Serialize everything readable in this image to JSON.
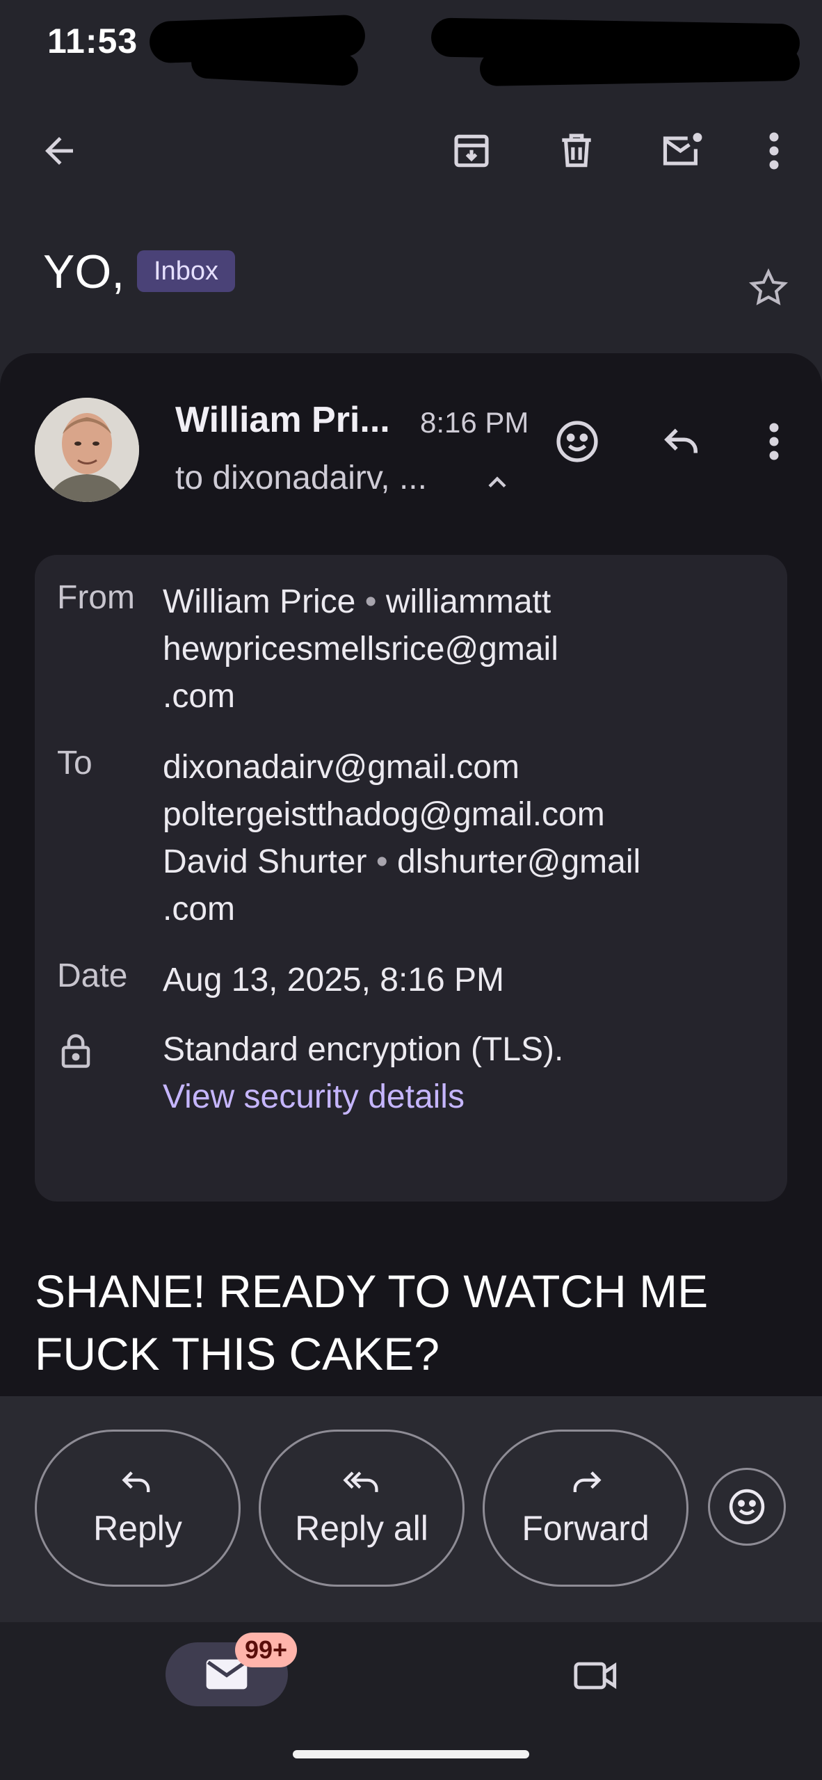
{
  "status_bar": {
    "time": "11:53"
  },
  "thread": {
    "subject": "YO,",
    "label": "Inbox"
  },
  "message": {
    "sender_short": "William Pri...",
    "time": "8:16 PM",
    "recipients_short": "to dixonadairv, ..."
  },
  "details": {
    "from_label": "From",
    "from_name": "William Price",
    "from_email_line1": "williammatt",
    "from_email_line2": "hewpricesmellsrice@gmail",
    "from_email_line3": ".com",
    "to_label": "To",
    "to_1": "dixonadairv@gmail.com",
    "to_2": "poltergeistthadog@gmail.com",
    "to_3_name": "David Shurter",
    "to_3_email_line1": "dlshurter@gmail",
    "to_3_email_line2": ".com",
    "date_label": "Date",
    "date": "Aug 13, 2025, 8:16 PM",
    "encryption": "Standard encryption (TLS).",
    "security_link": "View security details",
    "separator": "•"
  },
  "body": {
    "line1": "SHANE! READY TO WATCH ME",
    "line2": "FUCK THIS CAKE?"
  },
  "actions": {
    "reply": "Reply",
    "reply_all": "Reply all",
    "forward": "Forward"
  },
  "nav": {
    "mail_badge": "99+"
  },
  "colors": {
    "accent_chip": "#4a4277",
    "link": "#c6b6ff",
    "badge": "#ffb4ab",
    "card": "#16151b"
  }
}
